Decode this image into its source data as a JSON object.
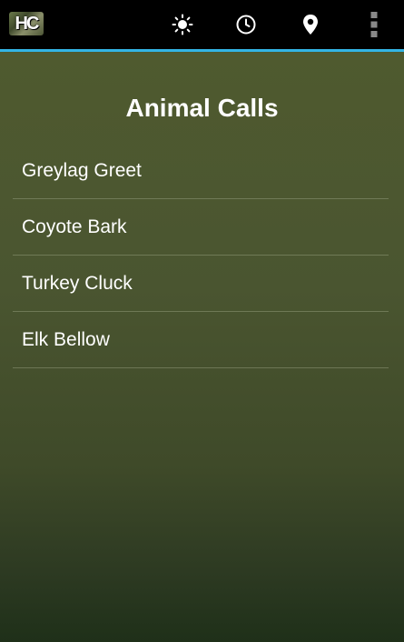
{
  "app": {
    "logo_text": "HC",
    "accent_color": "#33b5e5"
  },
  "actionbar": {
    "icons": [
      "brightness-icon",
      "clock-icon",
      "location-pin-icon",
      "overflow-menu-icon"
    ]
  },
  "main": {
    "title": "Animal Calls",
    "items": [
      {
        "label": "Greylag Greet"
      },
      {
        "label": "Coyote Bark"
      },
      {
        "label": "Turkey Cluck"
      },
      {
        "label": "Elk Bellow"
      }
    ]
  }
}
